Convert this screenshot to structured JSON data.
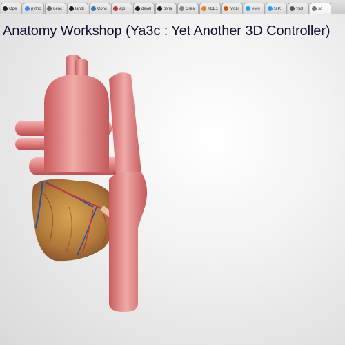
{
  "browser": {
    "tabs": [
      {
        "label": "Ope",
        "icon": "github-icon",
        "color": "#222222"
      },
      {
        "label": "pytho",
        "icon": "google-icon",
        "color": "#4285f4"
      },
      {
        "label": "Lenc",
        "icon": "page-icon",
        "color": "#666666"
      },
      {
        "label": "landi",
        "icon": "github-icon",
        "color": "#222222"
      },
      {
        "label": "Conc",
        "icon": "python-icon",
        "color": "#3b77a8"
      },
      {
        "label": "api",
        "icon": "page-icon",
        "color": "#c0392b"
      },
      {
        "label": "devel",
        "icon": "github-icon",
        "color": "#222222"
      },
      {
        "label": "olvia",
        "icon": "github-icon",
        "color": "#222222"
      },
      {
        "label": "Crea",
        "icon": "page-icon",
        "color": "#888888"
      },
      {
        "label": "#CE1",
        "icon": "page-icon",
        "color": "#e67e22"
      },
      {
        "label": "Mozi",
        "icon": "page-icon",
        "color": "#d35400"
      },
      {
        "label": "#Mo",
        "icon": "twitter-icon",
        "color": "#1da1f2"
      },
      {
        "label": "S.P.",
        "icon": "twitter-icon",
        "color": "#1da1f2"
      },
      {
        "label": "Ya3",
        "icon": "page-icon",
        "color": "#555555"
      },
      {
        "label": "sc",
        "icon": "page-icon",
        "color": "#777777",
        "active": true
      }
    ]
  },
  "page": {
    "title": "Anatomy Workshop (Ya3c : Yet Another 3D Controller)"
  },
  "model": {
    "subject": "3D heart model",
    "colors": {
      "aorta": "#e07f80",
      "vessel_highlight": "#f2b0ad",
      "myocardium": "#b8853f",
      "coronary_artery": "#c23a3a",
      "coronary_vein": "#2c4fa3"
    }
  }
}
